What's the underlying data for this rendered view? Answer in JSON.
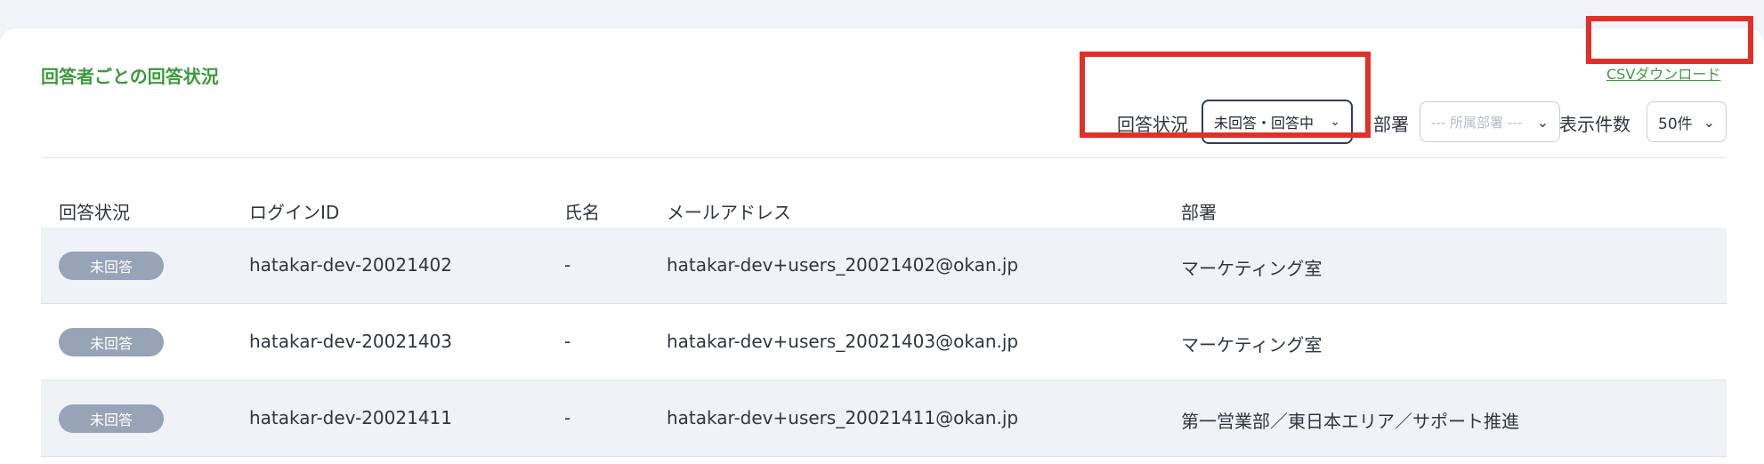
{
  "section": {
    "title": "回答者ごとの回答状況",
    "csv_link": "CSVダウンロード"
  },
  "filters": {
    "status_label": "回答状況",
    "status_value": "未回答・回答中",
    "dept_label": "部署",
    "dept_placeholder": "--- 所属部署 ---",
    "count_label": "表示件数",
    "count_value": "50件"
  },
  "table": {
    "headers": [
      "回答状況",
      "ログインID",
      "氏名",
      "メールアドレス",
      "部署"
    ],
    "rows": [
      {
        "status": "未回答",
        "login_id": "hatakar-dev-20021402",
        "name": "-",
        "email": "hatakar-dev+users_20021402@okan.jp",
        "dept": "マーケティング室"
      },
      {
        "status": "未回答",
        "login_id": "hatakar-dev-20021403",
        "name": "-",
        "email": "hatakar-dev+users_20021403@okan.jp",
        "dept": "マーケティング室"
      },
      {
        "status": "未回答",
        "login_id": "hatakar-dev-20021411",
        "name": "-",
        "email": "hatakar-dev+users_20021411@okan.jp",
        "dept": "第一営業部／東日本エリア／サポート推進"
      }
    ]
  },
  "colors": {
    "accent_green": "#3c9a3c",
    "highlight_red": "#e0302a",
    "badge_gray": "#97a3b6",
    "row_alt": "#eff3f8"
  },
  "icons": {
    "select_chevron": "chevron-down-icon"
  }
}
